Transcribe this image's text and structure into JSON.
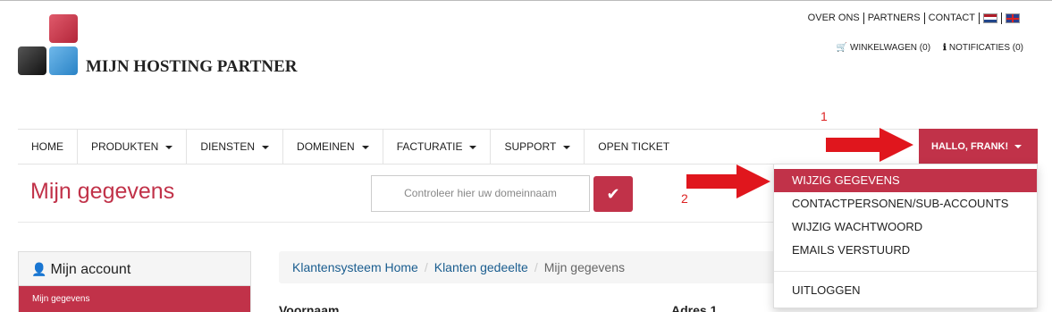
{
  "brand": {
    "name": "MIJN HOSTING PARTNER"
  },
  "top_links": [
    "OVER ONS",
    "PARTNERS",
    "CONTACT"
  ],
  "flags": [
    "nl-flag",
    "uk-flag"
  ],
  "cart": {
    "label": "WINKELWAGEN (0)",
    "icon": "cart-icon"
  },
  "notifications": {
    "label": "NOTIFICATIES (0)",
    "icon": "info-icon"
  },
  "nav": {
    "items": [
      {
        "label": "HOME",
        "dropdown": false
      },
      {
        "label": "PRODUKTEN",
        "dropdown": true
      },
      {
        "label": "DIENSTEN",
        "dropdown": true
      },
      {
        "label": "DOMEINEN",
        "dropdown": true
      },
      {
        "label": "FACTURATIE",
        "dropdown": true
      },
      {
        "label": "SUPPORT",
        "dropdown": true
      },
      {
        "label": "OPEN TICKET",
        "dropdown": false
      }
    ],
    "user_menu": "HALLO, FRANK!"
  },
  "page": {
    "title": "Mijn gegevens",
    "domain_placeholder": "Controleer hier uw domeinnaam"
  },
  "sidebar": {
    "heading": "Mijn account",
    "active_item": "Mijn gegevens"
  },
  "breadcrumb": [
    "Klantensysteem Home",
    "Klanten gedeelte",
    "Mijn gegevens"
  ],
  "fields": {
    "first_name_label": "Voornaam",
    "address_label": "Adres 1"
  },
  "user_dropdown": {
    "items": [
      "WIJZIG GEGEVENS",
      "CONTACTPERSONEN/SUB-ACCOUNTS",
      "WIJZIG WACHTWOORD",
      "EMAILS VERSTUURD"
    ],
    "logout": "UITLOGGEN"
  },
  "annotations": {
    "one": "1",
    "two": "2"
  },
  "colors": {
    "accent": "#c13249",
    "link": "#1a5d8f",
    "arrow": "#e0161d"
  }
}
